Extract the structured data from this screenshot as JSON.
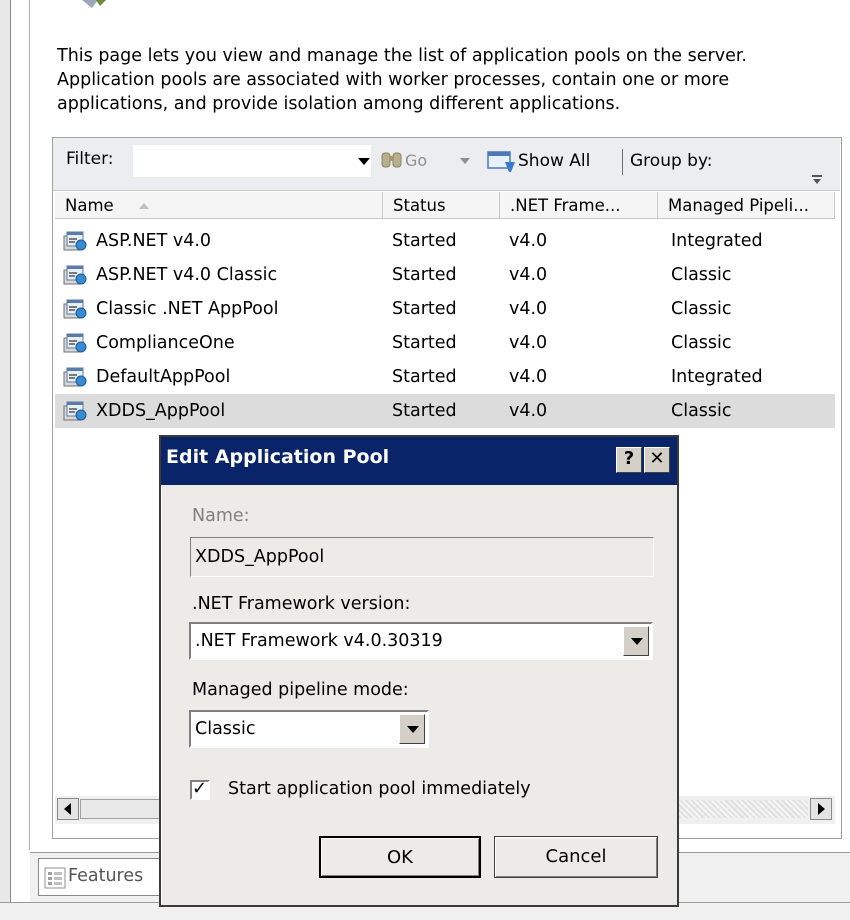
{
  "description": "This page lets you view and manage the list of application pools on the server. Application pools are associated with worker processes, contain one or more applications, and provide isolation among different applications.",
  "toolbar": {
    "filter_label": "Filter:",
    "filter_value": "",
    "go_label": "Go",
    "show_all_label": "Show All",
    "group_by_label": "Group by:"
  },
  "columns": [
    "Name",
    "Status",
    ".NET Frame...",
    "Managed Pipeli..."
  ],
  "pools": [
    {
      "name": "ASP.NET v4.0",
      "status": "Started",
      "framework": "v4.0",
      "pipeline": "Integrated"
    },
    {
      "name": "ASP.NET v4.0 Classic",
      "status": "Started",
      "framework": "v4.0",
      "pipeline": "Classic"
    },
    {
      "name": "Classic .NET AppPool",
      "status": "Started",
      "framework": "v4.0",
      "pipeline": "Classic"
    },
    {
      "name": "ComplianceOne",
      "status": "Started",
      "framework": "v4.0",
      "pipeline": "Classic"
    },
    {
      "name": "DefaultAppPool",
      "status": "Started",
      "framework": "v4.0",
      "pipeline": "Integrated"
    },
    {
      "name": "XDDS_AppPool",
      "status": "Started",
      "framework": "v4.0",
      "pipeline": "Classic"
    }
  ],
  "selected_row": 5,
  "bottom": {
    "features_tab": "Features"
  },
  "dialog": {
    "title": "Edit Application Pool",
    "help_symbol": "?",
    "close_symbol": "✕",
    "name_label": "Name:",
    "name_value": "XDDS_AppPool",
    "framework_label": ".NET Framework version:",
    "framework_value": ".NET Framework v4.0.30319",
    "pipeline_label": "Managed pipeline mode:",
    "pipeline_value": "Classic",
    "start_label": "Start application pool immediately",
    "start_checked": true,
    "ok_label": "OK",
    "cancel_label": "Cancel"
  },
  "colors": {
    "title_bar": "#0a246a",
    "selected_row": "#dcdcdc",
    "dialog_bg": "#ecebe7"
  }
}
